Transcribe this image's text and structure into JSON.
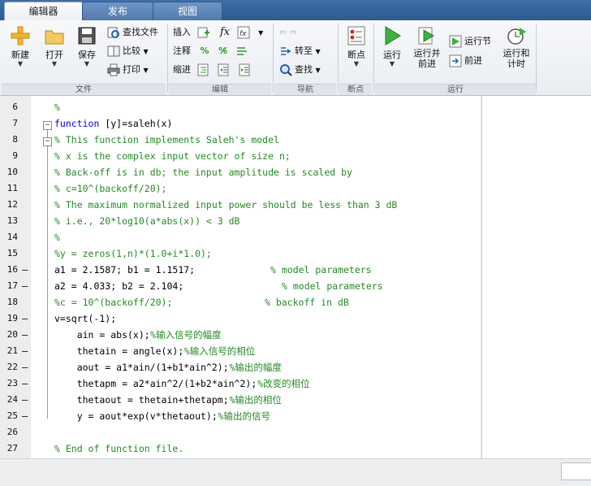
{
  "tabs": [
    {
      "label": "编辑器",
      "active": true
    },
    {
      "label": "发布",
      "active": false
    },
    {
      "label": "视图",
      "active": false
    }
  ],
  "ribbon": {
    "file": {
      "new": "新建",
      "open": "打开",
      "save": "保存",
      "find_files": "查找文件",
      "compare": "比较",
      "print": "打印",
      "group": "文件"
    },
    "edit": {
      "insert": "插入",
      "fx": "fx",
      "comment": "注释",
      "indent": "缩进",
      "group": "编辑"
    },
    "navigate": {
      "goto": "转至",
      "find": "查找",
      "group": "导航"
    },
    "breakpoints": {
      "breakpoint": "断点",
      "group": "断点"
    },
    "run": {
      "run": "运行",
      "run_advance_1": "运行并",
      "run_advance_2": "前进",
      "run_section": "运行节",
      "advance": "前进",
      "run_time_1": "运行和",
      "run_time_2": "计时",
      "group": "运行"
    }
  },
  "editor": {
    "lines": [
      {
        "num": "6",
        "dash": "",
        "text": "%"
      },
      {
        "num": "7",
        "dash": "",
        "kw": "function",
        "text": " [y]=saleh(x)"
      },
      {
        "num": "8",
        "dash": "",
        "text": "% This function implements Saleh's model"
      },
      {
        "num": "9",
        "dash": "",
        "text": "% x is the complex input vector of size n;"
      },
      {
        "num": "10",
        "dash": "",
        "text": "% Back-off is in db; the input amplitude is scaled by"
      },
      {
        "num": "11",
        "dash": "",
        "text": "% c=10^(backoff/20);"
      },
      {
        "num": "12",
        "dash": "",
        "text": "% The maximum normalized input power should be less than 3 dB"
      },
      {
        "num": "13",
        "dash": "",
        "text": "% i.e., 20*log10(a*abs(x)) < 3 dB"
      },
      {
        "num": "14",
        "dash": "",
        "text": "%"
      },
      {
        "num": "15",
        "dash": "",
        "text": "%y = zeros(1,n)*(1.0+i*1.0);"
      },
      {
        "num": "16",
        "dash": "–",
        "text": "a1 = 2.1587; b1 = 1.1517;",
        "comment": "% model parameters"
      },
      {
        "num": "17",
        "dash": "–",
        "text": "a2 = 4.033; b2 = 2.104;",
        "comment": "% model parameters"
      },
      {
        "num": "18",
        "dash": "",
        "text": "%c = 10^(backoff/20);",
        "comment": "% backoff in dB"
      },
      {
        "num": "19",
        "dash": "–",
        "text": "v=sqrt(-1);"
      },
      {
        "num": "20",
        "dash": "–",
        "text": "    ain = abs(x);",
        "comment": "%输入信号的幅度"
      },
      {
        "num": "21",
        "dash": "–",
        "text": "    thetain = angle(x);",
        "comment": "%输入信号的相位"
      },
      {
        "num": "22",
        "dash": "–",
        "text": "    aout = a1*ain/(1+b1*ain^2);",
        "comment": "%输出的幅度"
      },
      {
        "num": "23",
        "dash": "–",
        "text": "    thetapm = a2*ain^2/(1+b2*ain^2);",
        "comment": "%改变的相位"
      },
      {
        "num": "24",
        "dash": "–",
        "text": "    thetaout = thetain+thetapm;",
        "comment": "%输出的相位"
      },
      {
        "num": "25",
        "dash": "–",
        "text": "    y = aout*exp(v*thetaout);",
        "comment": "%输出的信号"
      },
      {
        "num": "26",
        "dash": "",
        "text": ""
      },
      {
        "num": "27",
        "dash": "",
        "text": "% End of function file."
      }
    ]
  },
  "colors": {
    "comment": "#228b22",
    "keyword": "#0000ff",
    "tab_strip": "#3a6aa5"
  },
  "icons": [
    "new-file-icon",
    "open-folder-icon",
    "save-icon",
    "find-files-icon",
    "compare-icon",
    "print-icon",
    "insert-icon",
    "fx-icon",
    "comment-icon",
    "indent-icon",
    "back-icon",
    "forward-icon",
    "goto-icon",
    "find-icon",
    "breakpoint-icon",
    "run-icon",
    "run-advance-icon",
    "run-section-icon",
    "advance-icon",
    "run-time-icon"
  ]
}
